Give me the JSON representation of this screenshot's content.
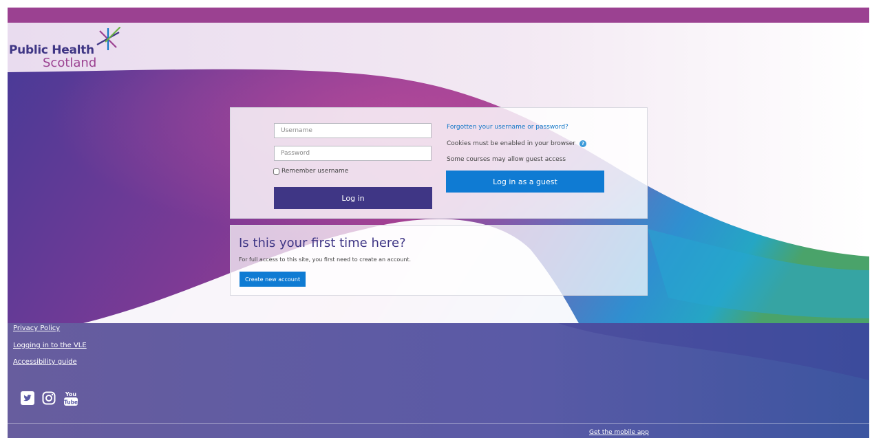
{
  "brand": {
    "line1": "Public Health",
    "line2": "Scotland"
  },
  "colors": {
    "top_bar": "#9b4191",
    "primary_purple": "#3f3685",
    "accent_blue": "#0f7bd3",
    "link_blue": "#1177c7"
  },
  "login": {
    "username_placeholder": "Username",
    "password_placeholder": "Password",
    "remember_label": "Remember username",
    "login_button": "Log in",
    "forgot_link": "Forgotten your username or password?",
    "cookies_note": "Cookies must be enabled in your browser",
    "guest_note": "Some courses may allow guest access",
    "guest_button": "Log in as a guest"
  },
  "signup": {
    "title": "Is this your first time here?",
    "description": "For full access to this site, you first need to create an account.",
    "create_button": "Create new account"
  },
  "footer": {
    "links": [
      "Privacy Policy",
      "Logging in to the VLE",
      "Accessibility guide"
    ],
    "social_icons": [
      "twitter-icon",
      "instagram-icon",
      "youtube-icon"
    ],
    "mobile_app": "Get the mobile app"
  }
}
